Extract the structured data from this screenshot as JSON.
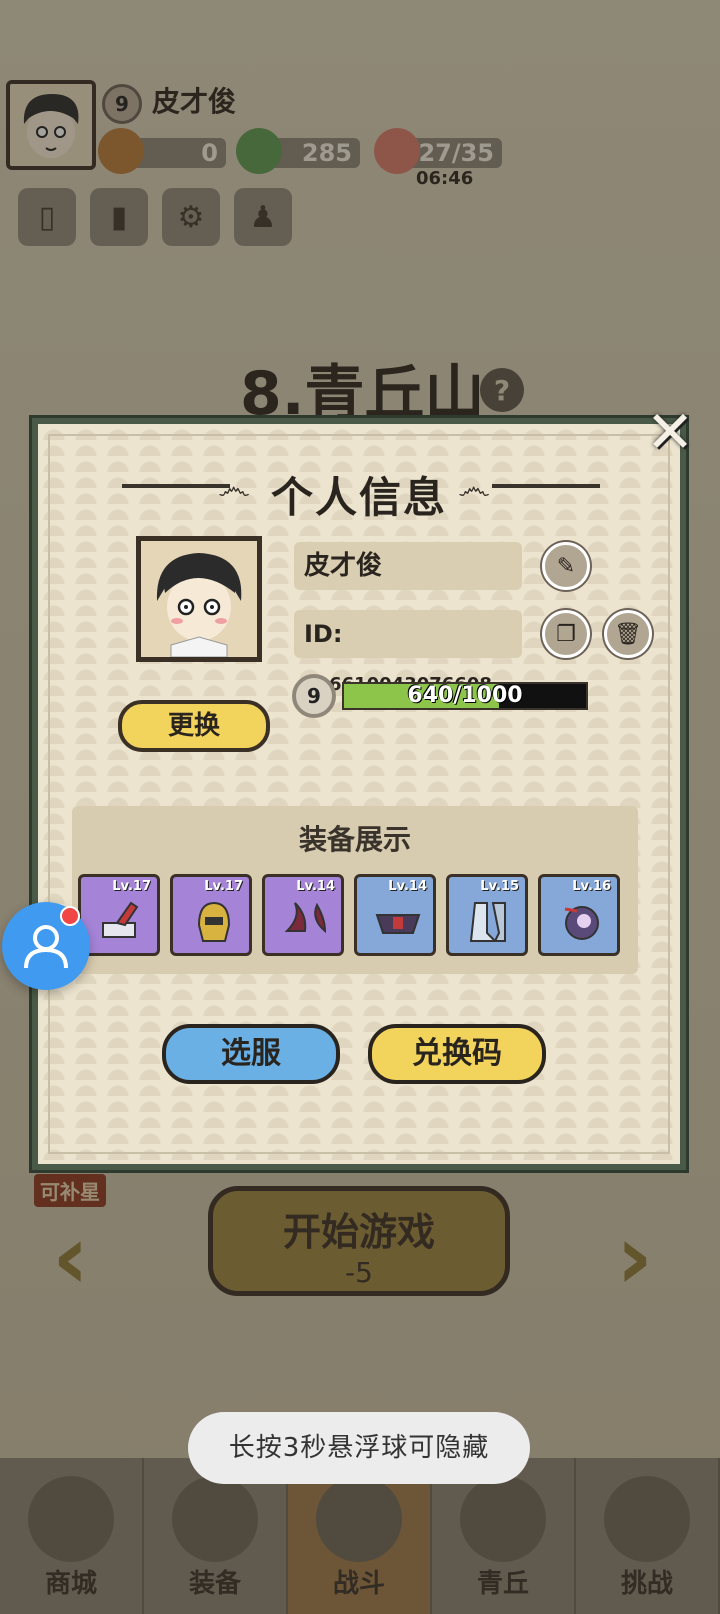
{
  "hud": {
    "level": "9",
    "player_name": "皮才俊",
    "resources": [
      {
        "icon": "gold-ingot-icon",
        "value": "0"
      },
      {
        "icon": "jade-icon",
        "value": "285"
      },
      {
        "icon": "peach-icon",
        "value": "27/35"
      }
    ],
    "timer": "06:46"
  },
  "stage": {
    "title": "8.青丘山",
    "help": "?",
    "start_label": "开始游戏",
    "start_cost": "-5",
    "side_tag": "可补星"
  },
  "bottom_nav": [
    {
      "label": "商城",
      "icon": "shop-icon"
    },
    {
      "label": "装备",
      "icon": "armor-icon"
    },
    {
      "label": "战斗",
      "icon": "swords-icon",
      "active": true
    },
    {
      "label": "青丘",
      "icon": "mountain-icon"
    },
    {
      "label": "挑战",
      "icon": "challenge-icon"
    }
  ],
  "dialog": {
    "title": "个人信息",
    "name": "皮才俊",
    "id_label": "ID:",
    "id_value": "536610043076608",
    "level": "9",
    "exp_text": "640/1000",
    "exp_fraction": 0.64,
    "change_label": "更换",
    "equip_title": "装备展示",
    "equipment": [
      {
        "level": "Lv.17",
        "rarity": "purple",
        "icon": "hammer-icon"
      },
      {
        "level": "Lv.17",
        "rarity": "purple",
        "icon": "helmet-icon"
      },
      {
        "level": "Lv.14",
        "rarity": "purple",
        "icon": "horns-icon"
      },
      {
        "level": "Lv.14",
        "rarity": "blue",
        "icon": "belt-icon"
      },
      {
        "level": "Lv.15",
        "rarity": "blue",
        "icon": "boots-icon"
      },
      {
        "level": "Lv.16",
        "rarity": "blue",
        "icon": "orb-icon"
      }
    ],
    "server_label": "选服",
    "code_label": "兑换码"
  },
  "toast": "长按3秒悬浮球可隐藏",
  "colors": {
    "purple": "#a584d8",
    "blue": "#86a8d8",
    "yellow_button": "#f2d35c",
    "blue_button": "#6ab0e4",
    "exp_fill": "#8dc54a"
  }
}
